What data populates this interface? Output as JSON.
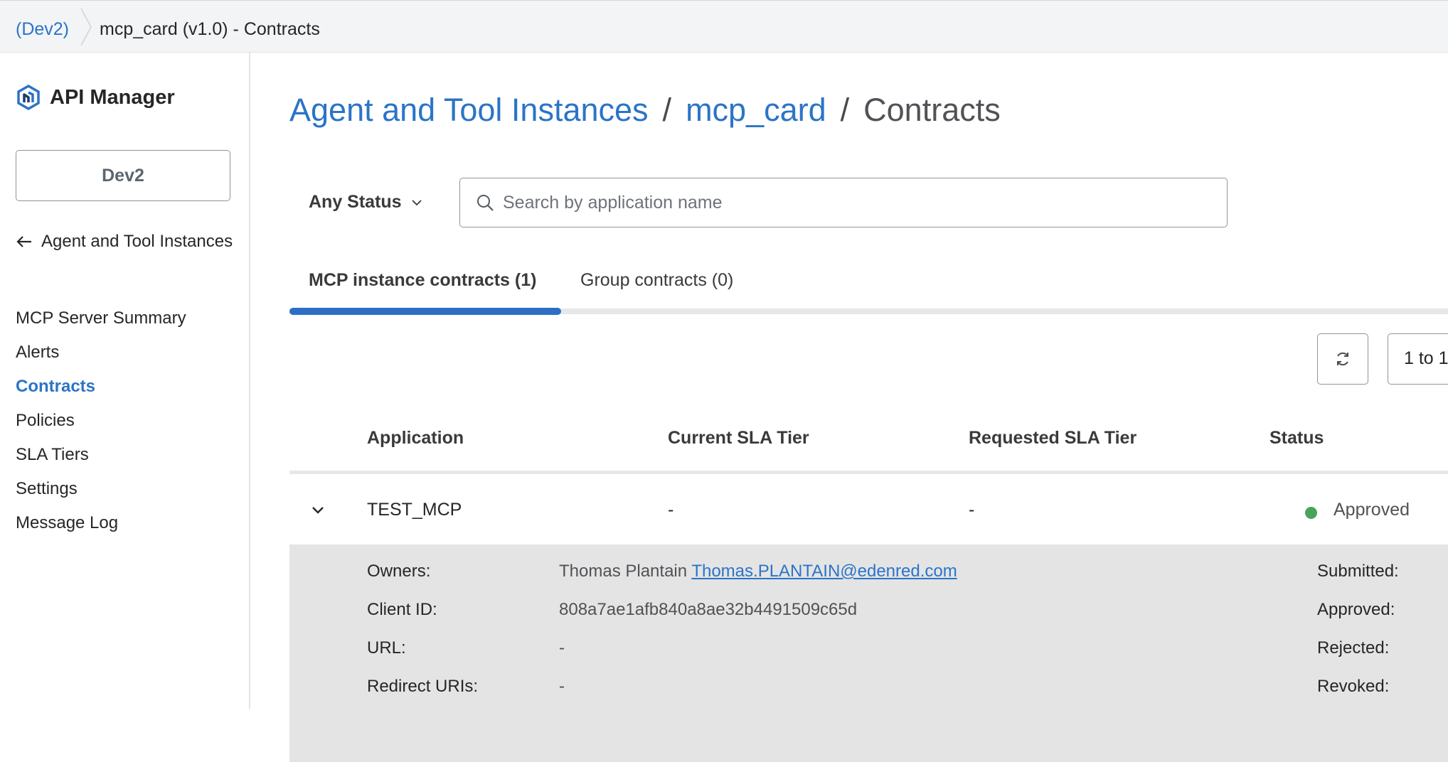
{
  "topbar": {
    "env_crumb": "(Dev2)",
    "page_crumb": "mcp_card (v1.0) - Contracts"
  },
  "sidebar": {
    "brand": "API Manager",
    "env_button": "Dev2",
    "back_link": "Agent and Tool Instances",
    "items": [
      {
        "label": "MCP Server Summary",
        "active": false
      },
      {
        "label": "Alerts",
        "active": false
      },
      {
        "label": "Contracts",
        "active": true
      },
      {
        "label": "Policies",
        "active": false
      },
      {
        "label": "SLA Tiers",
        "active": false
      },
      {
        "label": "Settings",
        "active": false
      },
      {
        "label": "Message Log",
        "active": false
      }
    ]
  },
  "header": {
    "title_parts": [
      "Agent and Tool Instances",
      "mcp_card",
      "Contracts"
    ],
    "separator": "/"
  },
  "filters": {
    "status_label": "Any Status",
    "search_placeholder": "Search by application name",
    "search_value": ""
  },
  "tabs": [
    {
      "label": "MCP instance contracts (1)",
      "active": true
    },
    {
      "label": "Group contracts (0)",
      "active": false
    }
  ],
  "toolbar": {
    "pagination": "1 to 1"
  },
  "table": {
    "columns": [
      "Application",
      "Current SLA Tier",
      "Requested SLA Tier",
      "Status"
    ],
    "rows": [
      {
        "application": "TEST_MCP",
        "current_sla": "-",
        "requested_sla": "-",
        "status": "Approved",
        "expanded": true
      }
    ]
  },
  "details": {
    "owners_label": "Owners:",
    "owner_name": "Thomas Plantain",
    "owner_email": "Thomas.PLANTAIN@edenred.com",
    "client_id_label": "Client ID:",
    "client_id": "808a7ae1afb840a8ae32b4491509c65d",
    "url_label": "URL:",
    "url": "-",
    "redirect_label": "Redirect URIs:",
    "redirect": "-",
    "submitted_label": "Submitted:",
    "approved_label": "Approved:",
    "rejected_label": "Rejected:",
    "revoked_label": "Revoked:"
  },
  "colors": {
    "accent": "#2b74c8",
    "status_approved": "#4aa35a",
    "details_bg": "#e4e4e4"
  },
  "icons": [
    "logo-icon",
    "arrow-left-icon",
    "chevron-down-icon",
    "search-icon",
    "refresh-icon",
    "caret-down-icon"
  ]
}
